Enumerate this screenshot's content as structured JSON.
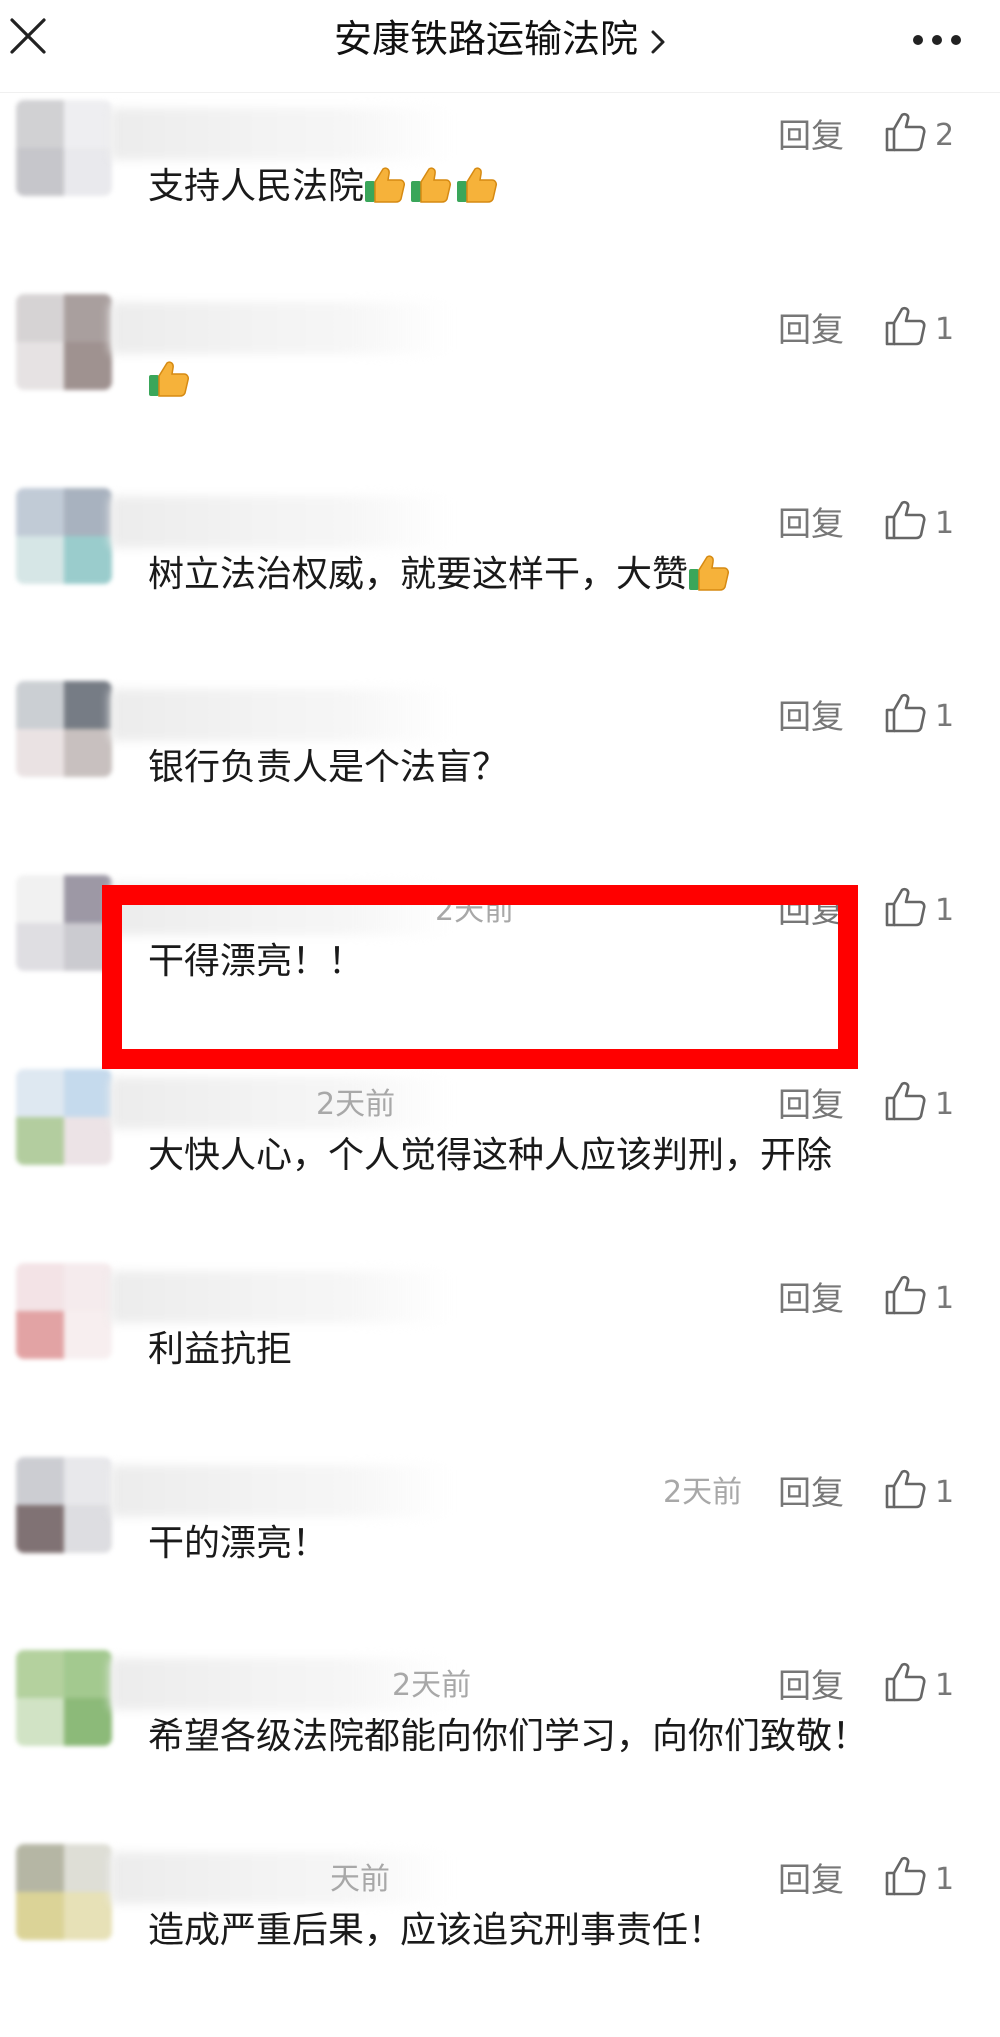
{
  "header": {
    "title": "安康铁路运输法院",
    "chevron_icon": "chevron-right-icon",
    "close_icon": "close-icon",
    "more_icon": "more-horizontal-icon"
  },
  "comments": [
    {
      "time": "",
      "reply": "回复",
      "likes": "2",
      "text": "支持人民法院",
      "emoji_count": 3,
      "avatar": [
        "#c9c9cc",
        "#ececef",
        "#bdbdc2",
        "#e6e6ea"
      ]
    },
    {
      "time": "",
      "reply": "回复",
      "likes": "1",
      "text": "",
      "emoji_count": 1,
      "avatar": [
        "#d0cccd",
        "#9b8f8e",
        "#e2dedf",
        "#8f7f7d"
      ]
    },
    {
      "time": "",
      "reply": "回复",
      "likes": "1",
      "text": "树立法治权威，就要这样干，大赞",
      "emoji_count": 1,
      "avatar": [
        "#b7c2d0",
        "#9aa5b4",
        "#cfe2e2",
        "#89c4c4"
      ]
    },
    {
      "time": "",
      "reply": "回复",
      "likes": "1",
      "text": "银行负责人是个法盲？",
      "emoji_count": 0,
      "avatar": [
        "#c3c7cc",
        "#5f6670",
        "#e7dedf",
        "#bfb6b4"
      ]
    },
    {
      "time": "2天前",
      "reply": "回复",
      "likes": "1",
      "text": "干得漂亮！！",
      "emoji_count": 0,
      "avatar": [
        "#efefef",
        "#8c8796",
        "#dad9de",
        "#c3c2c8"
      ]
    },
    {
      "time": "2天前",
      "reply": "回复",
      "likes": "1",
      "text": "大快人心，个人觉得这种人应该判刑，开除",
      "emoji_count": 0,
      "avatar": [
        "#d9e4ef",
        "#bcd4ea",
        "#a6c58f",
        "#e9dfe2"
      ]
    },
    {
      "time": "",
      "reply": "回复",
      "likes": "1",
      "text": "利益抗拒",
      "emoji_count": 0,
      "avatar": [
        "#f1dfe2",
        "#f4e8ea",
        "#de9495",
        "#f6eced"
      ]
    },
    {
      "time": "2天前",
      "reply": "回复",
      "likes": "1",
      "text": "干的漂亮！",
      "emoji_count": 0,
      "avatar": [
        "#c4c5cb",
        "#e4e4e8",
        "#6b5a5c",
        "#d8d8dc"
      ]
    },
    {
      "time": "2天前",
      "reply": "回复",
      "likes": "1",
      "text": "希望各级法院都能向你们学习，向你们致敬！",
      "emoji_count": 0,
      "avatar": [
        "#a7c98e",
        "#93c07c",
        "#c9dfbb",
        "#79ae62"
      ]
    },
    {
      "time": "天前",
      "reply": "回复",
      "likes": "1",
      "text": "造成严重后果，应该追究刑事责任！",
      "emoji_count": 0,
      "avatar": [
        "#a9aa95",
        "#d9d9cf",
        "#d5cc86",
        "#e3dcab"
      ]
    }
  ]
}
